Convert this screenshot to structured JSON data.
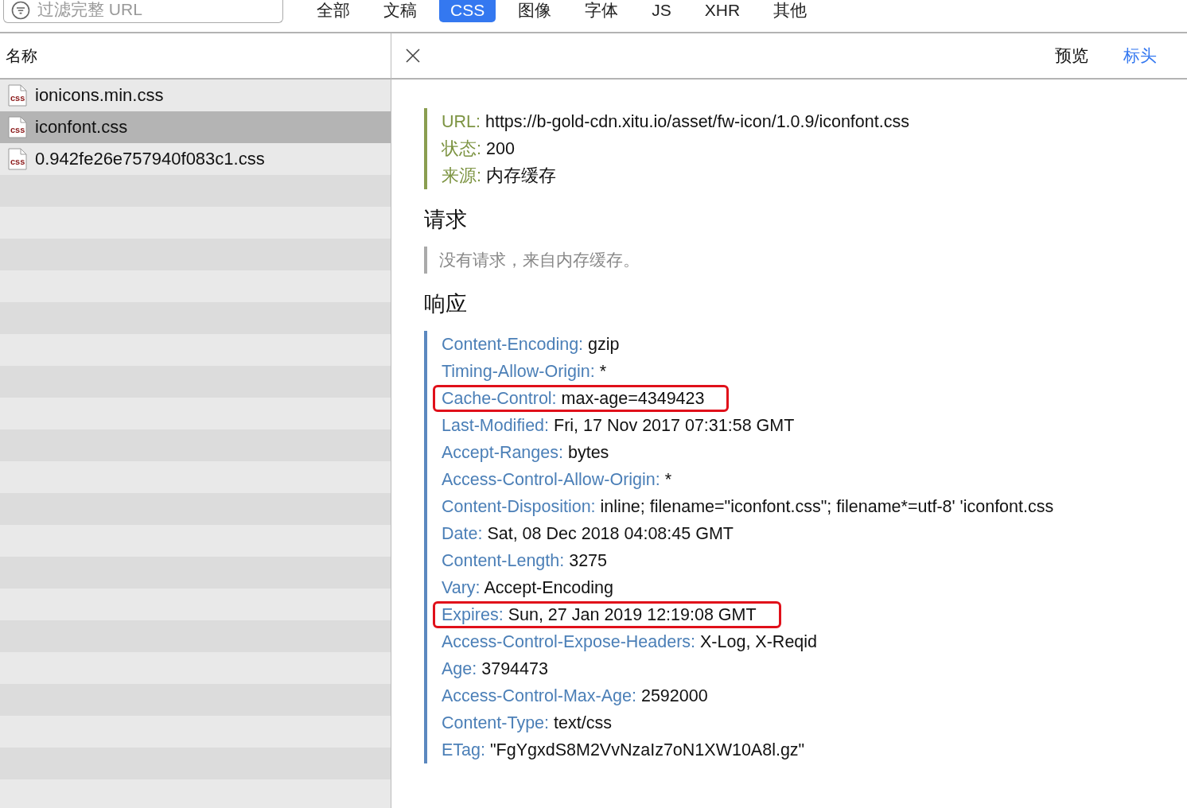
{
  "filter": {
    "placeholder": "过滤完整 URL"
  },
  "type_tabs": [
    {
      "label": "全部",
      "selected": false
    },
    {
      "label": "文稿",
      "selected": false
    },
    {
      "label": "CSS",
      "selected": true
    },
    {
      "label": "图像",
      "selected": false
    },
    {
      "label": "字体",
      "selected": false
    },
    {
      "label": "JS",
      "selected": false
    },
    {
      "label": "XHR",
      "selected": false
    },
    {
      "label": "其他",
      "selected": false
    }
  ],
  "resource_list": {
    "column": "名称",
    "rows": [
      {
        "name": "ionicons.min.css",
        "icon_label": "css",
        "selected": false
      },
      {
        "name": "iconfont.css",
        "icon_label": "css",
        "selected": true
      },
      {
        "name": "0.942fe26e757940f083c1.css",
        "icon_label": "css",
        "selected": false
      }
    ]
  },
  "detail_tabs": [
    {
      "label": "预览",
      "selected": false
    },
    {
      "label": "标头",
      "selected": true
    }
  ],
  "sections": [
    {
      "kind": "summary",
      "lines": [
        {
          "key": "URL:",
          "value": "https://b-gold-cdn.xitu.io/asset/fw-icon/1.0.9/iconfont.css",
          "highlighted": false
        },
        {
          "key": "状态:",
          "value": "200",
          "highlighted": false
        },
        {
          "key": "来源:",
          "value": "内存缓存",
          "highlighted": false
        }
      ]
    },
    {
      "kind": "note",
      "title": "请求",
      "note": "没有请求，来自内存缓存。"
    },
    {
      "kind": "headers",
      "title": "响应",
      "lines": [
        {
          "key": "Content-Encoding:",
          "value": "gzip",
          "highlighted": false
        },
        {
          "key": "Timing-Allow-Origin:",
          "value": "*",
          "highlighted": false
        },
        {
          "key": "Cache-Control:",
          "value": "max-age=4349423",
          "highlighted": true
        },
        {
          "key": "Last-Modified:",
          "value": "Fri, 17 Nov 2017 07:31:58 GMT",
          "highlighted": false
        },
        {
          "key": "Accept-Ranges:",
          "value": "bytes",
          "highlighted": false
        },
        {
          "key": "Access-Control-Allow-Origin:",
          "value": "*",
          "highlighted": false
        },
        {
          "key": "Content-Disposition:",
          "value": "inline; filename=\"iconfont.css\"; filename*=utf-8' 'iconfont.css",
          "highlighted": false
        },
        {
          "key": "Date:",
          "value": "Sat, 08 Dec 2018 04:08:45 GMT",
          "highlighted": false
        },
        {
          "key": "Content-Length:",
          "value": "3275",
          "highlighted": false
        },
        {
          "key": "Vary:",
          "value": "Accept-Encoding",
          "highlighted": false
        },
        {
          "key": "Expires:",
          "value": "Sun, 27 Jan 2019 12:19:08 GMT",
          "highlighted": true
        },
        {
          "key": "Access-Control-Expose-Headers:",
          "value": "X-Log, X-Reqid",
          "highlighted": false
        },
        {
          "key": "Age:",
          "value": "3794473",
          "highlighted": false
        },
        {
          "key": "Access-Control-Max-Age:",
          "value": "2592000",
          "highlighted": false
        },
        {
          "key": "Content-Type:",
          "value": "text/css",
          "highlighted": false
        },
        {
          "key": "ETag:",
          "value": "\"FgYgxdS8M2VvNzaIz7oN1XW10A8l.gz\"",
          "highlighted": false
        }
      ]
    }
  ]
}
